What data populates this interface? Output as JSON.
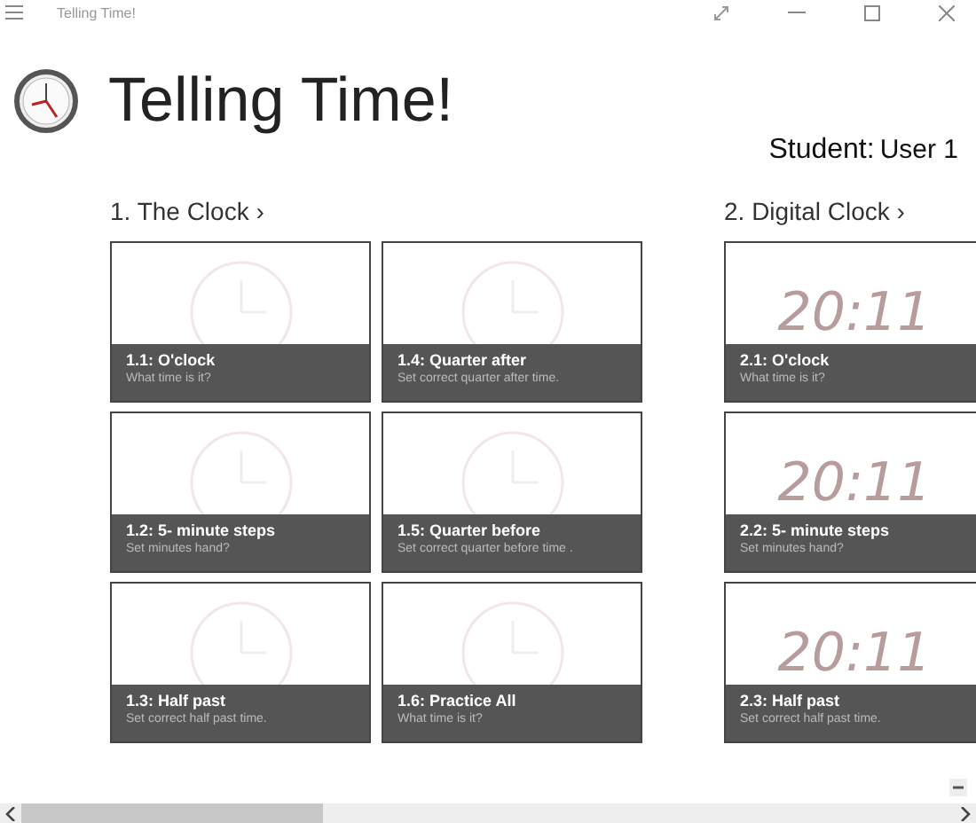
{
  "window": {
    "title": "Telling Time!"
  },
  "header": {
    "title": "Telling Time!",
    "student_label": "Student:",
    "student_name": "User 1"
  },
  "sections": [
    {
      "title": "1. The Clock ›",
      "tiles": [
        {
          "kind": "analog",
          "title": "1.1: O'clock",
          "subtitle": "What time is it?"
        },
        {
          "kind": "analog",
          "title": "1.2: 5- minute steps",
          "subtitle": "Set minutes hand?"
        },
        {
          "kind": "analog",
          "title": "1.3: Half past",
          "subtitle": "Set correct half past time."
        },
        {
          "kind": "analog",
          "title": "1.4: Quarter after",
          "subtitle": "Set correct quarter after time."
        },
        {
          "kind": "analog",
          "title": "1.5: Quarter before",
          "subtitle": "Set correct quarter before time ."
        },
        {
          "kind": "analog",
          "title": "1.6: Practice All",
          "subtitle": "What time is it?"
        }
      ]
    },
    {
      "title": "2. Digital Clock ›",
      "tiles": [
        {
          "kind": "digital",
          "face": "20:11",
          "title": "2.1: O'clock",
          "subtitle": "What time is it?"
        },
        {
          "kind": "digital",
          "face": "20:11",
          "title": "2.2: 5- minute steps",
          "subtitle": "Set minutes hand?"
        },
        {
          "kind": "digital",
          "face": "20:11",
          "title": "2.3: Half past",
          "subtitle": "Set correct half past time."
        }
      ]
    }
  ]
}
